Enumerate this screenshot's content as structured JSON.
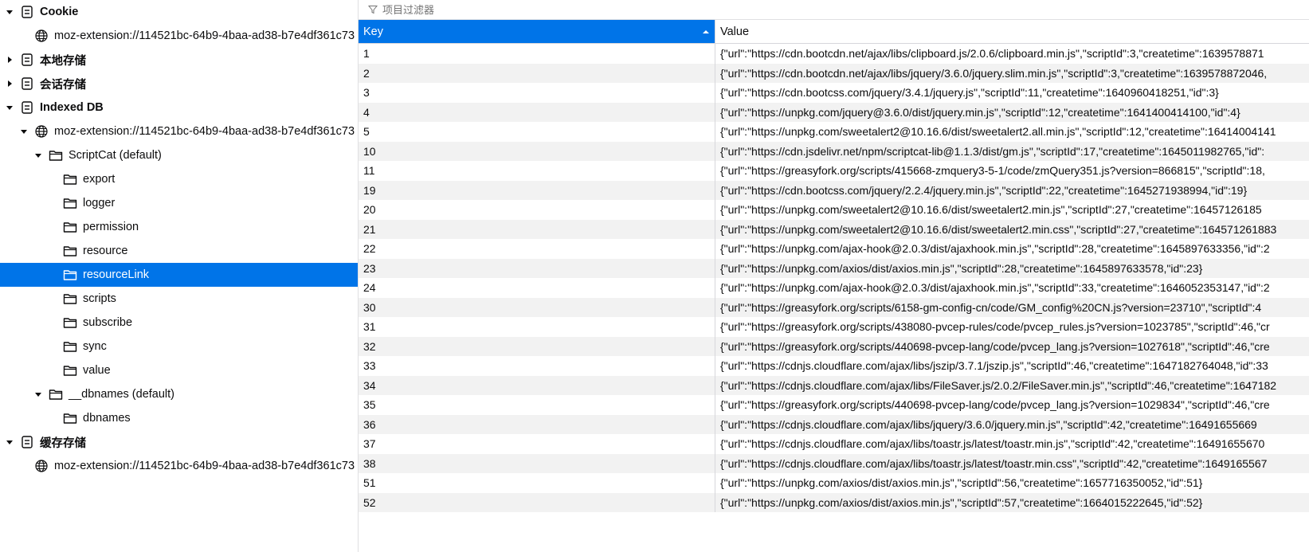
{
  "tree": [
    {
      "label": "Cookie",
      "bold": true,
      "depth": 0,
      "twisty": "open",
      "icon": "storage-icon"
    },
    {
      "label": "moz-extension://114521bc-64b9-4baa-ad38-b7e4df361c73",
      "bold": false,
      "depth": 1,
      "twisty": "none",
      "icon": "globe-icon"
    },
    {
      "label": "本地存储",
      "bold": true,
      "depth": 0,
      "twisty": "closed",
      "icon": "storage-icon"
    },
    {
      "label": "会话存储",
      "bold": true,
      "depth": 0,
      "twisty": "closed",
      "icon": "storage-icon"
    },
    {
      "label": "Indexed DB",
      "bold": true,
      "depth": 0,
      "twisty": "open",
      "icon": "storage-icon"
    },
    {
      "label": "moz-extension://114521bc-64b9-4baa-ad38-b7e4df361c73",
      "bold": false,
      "depth": 1,
      "twisty": "open",
      "icon": "globe-icon"
    },
    {
      "label": "ScriptCat (default)",
      "bold": false,
      "depth": 2,
      "twisty": "open",
      "icon": "folder-icon"
    },
    {
      "label": "export",
      "bold": false,
      "depth": 3,
      "twisty": "none",
      "icon": "folder-icon"
    },
    {
      "label": "logger",
      "bold": false,
      "depth": 3,
      "twisty": "none",
      "icon": "folder-icon"
    },
    {
      "label": "permission",
      "bold": false,
      "depth": 3,
      "twisty": "none",
      "icon": "folder-icon"
    },
    {
      "label": "resource",
      "bold": false,
      "depth": 3,
      "twisty": "none",
      "icon": "folder-icon"
    },
    {
      "label": "resourceLink",
      "bold": false,
      "depth": 3,
      "twisty": "none",
      "icon": "folder-icon",
      "selected": true
    },
    {
      "label": "scripts",
      "bold": false,
      "depth": 3,
      "twisty": "none",
      "icon": "folder-icon"
    },
    {
      "label": "subscribe",
      "bold": false,
      "depth": 3,
      "twisty": "none",
      "icon": "folder-icon"
    },
    {
      "label": "sync",
      "bold": false,
      "depth": 3,
      "twisty": "none",
      "icon": "folder-icon"
    },
    {
      "label": "value",
      "bold": false,
      "depth": 3,
      "twisty": "none",
      "icon": "folder-icon"
    },
    {
      "label": "__dbnames (default)",
      "bold": false,
      "depth": 2,
      "twisty": "open",
      "icon": "folder-icon"
    },
    {
      "label": "dbnames",
      "bold": false,
      "depth": 3,
      "twisty": "none",
      "icon": "folder-icon"
    },
    {
      "label": "缓存存储",
      "bold": true,
      "depth": 0,
      "twisty": "open",
      "icon": "storage-icon"
    },
    {
      "label": "moz-extension://114521bc-64b9-4baa-ad38-b7e4df361c73",
      "bold": false,
      "depth": 1,
      "twisty": "none",
      "icon": "globe-icon"
    }
  ],
  "filter": {
    "placeholder": "项目过滤器",
    "value": ""
  },
  "table": {
    "columns": {
      "key": "Key",
      "value": "Value"
    },
    "rows": [
      {
        "key": "1",
        "value": "{\"url\":\"https://cdn.bootcdn.net/ajax/libs/clipboard.js/2.0.6/clipboard.min.js\",\"scriptId\":3,\"createtime\":1639578871"
      },
      {
        "key": "2",
        "value": "{\"url\":\"https://cdn.bootcdn.net/ajax/libs/jquery/3.6.0/jquery.slim.min.js\",\"scriptId\":3,\"createtime\":1639578872046,"
      },
      {
        "key": "3",
        "value": "{\"url\":\"https://cdn.bootcss.com/jquery/3.4.1/jquery.js\",\"scriptId\":11,\"createtime\":1640960418251,\"id\":3}"
      },
      {
        "key": "4",
        "value": "{\"url\":\"https://unpkg.com/jquery@3.6.0/dist/jquery.min.js\",\"scriptId\":12,\"createtime\":1641400414100,\"id\":4}"
      },
      {
        "key": "5",
        "value": "{\"url\":\"https://unpkg.com/sweetalert2@10.16.6/dist/sweetalert2.all.min.js\",\"scriptId\":12,\"createtime\":16414004141"
      },
      {
        "key": "10",
        "value": "{\"url\":\"https://cdn.jsdelivr.net/npm/scriptcat-lib@1.1.3/dist/gm.js\",\"scriptId\":17,\"createtime\":1645011982765,\"id\":"
      },
      {
        "key": "11",
        "value": "{\"url\":\"https://greasyfork.org/scripts/415668-zmquery3-5-1/code/zmQuery351.js?version=866815\",\"scriptId\":18,"
      },
      {
        "key": "19",
        "value": "{\"url\":\"https://cdn.bootcss.com/jquery/2.2.4/jquery.min.js\",\"scriptId\":22,\"createtime\":1645271938994,\"id\":19}"
      },
      {
        "key": "20",
        "value": "{\"url\":\"https://unpkg.com/sweetalert2@10.16.6/dist/sweetalert2.min.js\",\"scriptId\":27,\"createtime\":16457126185"
      },
      {
        "key": "21",
        "value": "{\"url\":\"https://unpkg.com/sweetalert2@10.16.6/dist/sweetalert2.min.css\",\"scriptId\":27,\"createtime\":164571261883"
      },
      {
        "key": "22",
        "value": "{\"url\":\"https://unpkg.com/ajax-hook@2.0.3/dist/ajaxhook.min.js\",\"scriptId\":28,\"createtime\":1645897633356,\"id\":2"
      },
      {
        "key": "23",
        "value": "{\"url\":\"https://unpkg.com/axios/dist/axios.min.js\",\"scriptId\":28,\"createtime\":1645897633578,\"id\":23}"
      },
      {
        "key": "24",
        "value": "{\"url\":\"https://unpkg.com/ajax-hook@2.0.3/dist/ajaxhook.min.js\",\"scriptId\":33,\"createtime\":1646052353147,\"id\":2"
      },
      {
        "key": "30",
        "value": "{\"url\":\"https://greasyfork.org/scripts/6158-gm-config-cn/code/GM_config%20CN.js?version=23710\",\"scriptId\":4"
      },
      {
        "key": "31",
        "value": "{\"url\":\"https://greasyfork.org/scripts/438080-pvcep-rules/code/pvcep_rules.js?version=1023785\",\"scriptId\":46,\"cr"
      },
      {
        "key": "32",
        "value": "{\"url\":\"https://greasyfork.org/scripts/440698-pvcep-lang/code/pvcep_lang.js?version=1027618\",\"scriptId\":46,\"cre"
      },
      {
        "key": "33",
        "value": "{\"url\":\"https://cdnjs.cloudflare.com/ajax/libs/jszip/3.7.1/jszip.js\",\"scriptId\":46,\"createtime\":1647182764048,\"id\":33"
      },
      {
        "key": "34",
        "value": "{\"url\":\"https://cdnjs.cloudflare.com/ajax/libs/FileSaver.js/2.0.2/FileSaver.min.js\",\"scriptId\":46,\"createtime\":1647182"
      },
      {
        "key": "35",
        "value": "{\"url\":\"https://greasyfork.org/scripts/440698-pvcep-lang/code/pvcep_lang.js?version=1029834\",\"scriptId\":46,\"cre"
      },
      {
        "key": "36",
        "value": "{\"url\":\"https://cdnjs.cloudflare.com/ajax/libs/jquery/3.6.0/jquery.min.js\",\"scriptId\":42,\"createtime\":16491655669"
      },
      {
        "key": "37",
        "value": "{\"url\":\"https://cdnjs.cloudflare.com/ajax/libs/toastr.js/latest/toastr.min.js\",\"scriptId\":42,\"createtime\":16491655670"
      },
      {
        "key": "38",
        "value": "{\"url\":\"https://cdnjs.cloudflare.com/ajax/libs/toastr.js/latest/toastr.min.css\",\"scriptId\":42,\"createtime\":1649165567"
      },
      {
        "key": "51",
        "value": "{\"url\":\"https://unpkg.com/axios/dist/axios.min.js\",\"scriptId\":56,\"createtime\":1657716350052,\"id\":51}"
      },
      {
        "key": "52",
        "value": "{\"url\":\"https://unpkg.com/axios/dist/axios.min.js\",\"scriptId\":57,\"createtime\":1664015222645,\"id\":52}"
      }
    ]
  },
  "colors": {
    "selection": "#0074e8",
    "stripe": "#f2f2f2",
    "border": "#d7d7db",
    "text": "#0c0c0d"
  }
}
